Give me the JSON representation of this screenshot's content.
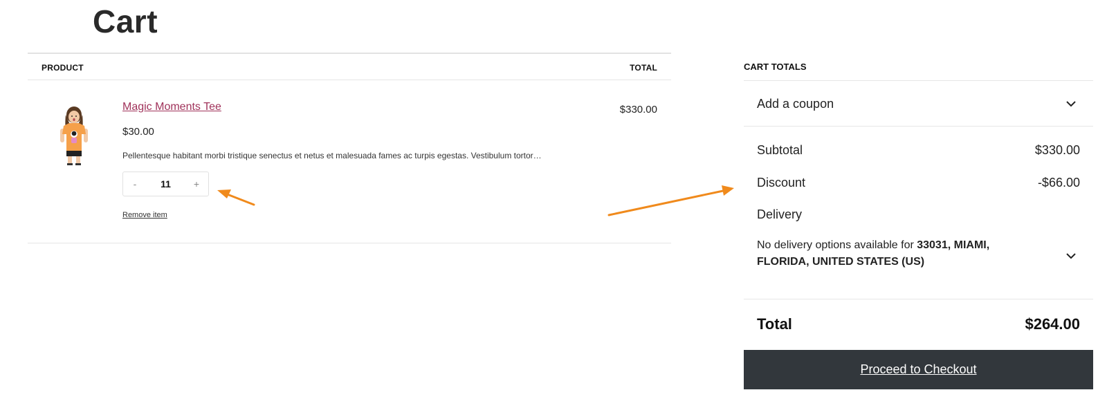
{
  "page": {
    "title": "Cart"
  },
  "table": {
    "headers": {
      "product": "PRODUCT",
      "total": "TOTAL"
    },
    "items": [
      {
        "name": "Magic Moments Tee",
        "price": "$30.00",
        "description": "Pellentesque habitant morbi tristique senectus et netus et malesuada fames ac turpis egestas. Vestibulum tortor…",
        "quantity": "11",
        "qty_minus": "-",
        "qty_plus": "+",
        "remove_label": "Remove item",
        "line_total": "$330.00"
      }
    ]
  },
  "totals": {
    "heading": "CART TOTALS",
    "coupon_label": "Add a coupon",
    "subtotal_label": "Subtotal",
    "subtotal_value": "$330.00",
    "discount_label": "Discount",
    "discount_value": "-$66.00",
    "delivery_label": "Delivery",
    "delivery_note_prefix": "No delivery options available for ",
    "delivery_note_location": "33031, MIAMI, FLORIDA, UNITED STATES (US)",
    "total_label": "Total",
    "total_value": "$264.00",
    "checkout_label": "Proceed to Checkout"
  },
  "colors": {
    "product_link": "#a0325a",
    "checkout_button": "#32373c",
    "annotation_arrow": "#f08a1c",
    "tee_orange": "#f5a04a"
  },
  "icons": [
    "chevron-down-icon",
    "annotation-arrow"
  ]
}
